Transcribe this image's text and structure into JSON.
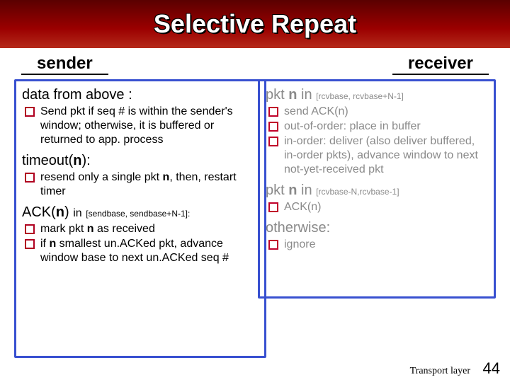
{
  "title": "Selective Repeat",
  "roles": {
    "sender_label": "sender",
    "receiver_label": "receiver"
  },
  "sender": {
    "s1_heading": "data from above :",
    "s1_items": [
      "Send pkt if seq # is within the sender's window; otherwise, it is buffered or returned to app. process"
    ],
    "s2_heading_html": "timeout(<b>n</b>):",
    "s2_items_html": [
      "resend only a single pkt <b>n</b>, then, restart timer"
    ],
    "s3_heading_html": "ACK(<b>n</b>) <span style='font-size:16px'>in</span> <span class='small'>[sendbase, sendbase+N-1]:</span>",
    "s3_items_html": [
      "mark pkt <b>n</b> as received",
      "if <b>n</b> smallest un.ACKed pkt, advance window base to next un.ACKed seq #"
    ]
  },
  "receiver": {
    "r1_heading_html": "pkt <b>n</b> in <span class='small'>[rcvbase, rcvbase+N-1]</span>",
    "r1_items": [
      "send ACK(n)",
      "out-of-order: place in buffer",
      "in-order: deliver (also deliver buffered, in-order pkts), advance window to next not-yet-received pkt"
    ],
    "r2_heading_html": "pkt <b>n</b> in <span class='small'>[rcvbase-N,rcvbase-1]</span>",
    "r2_items": [
      "ACK(n)"
    ],
    "r3_heading": "otherwise:",
    "r3_items": [
      "ignore"
    ]
  },
  "footer": {
    "label": "Transport layer",
    "page": "44"
  }
}
